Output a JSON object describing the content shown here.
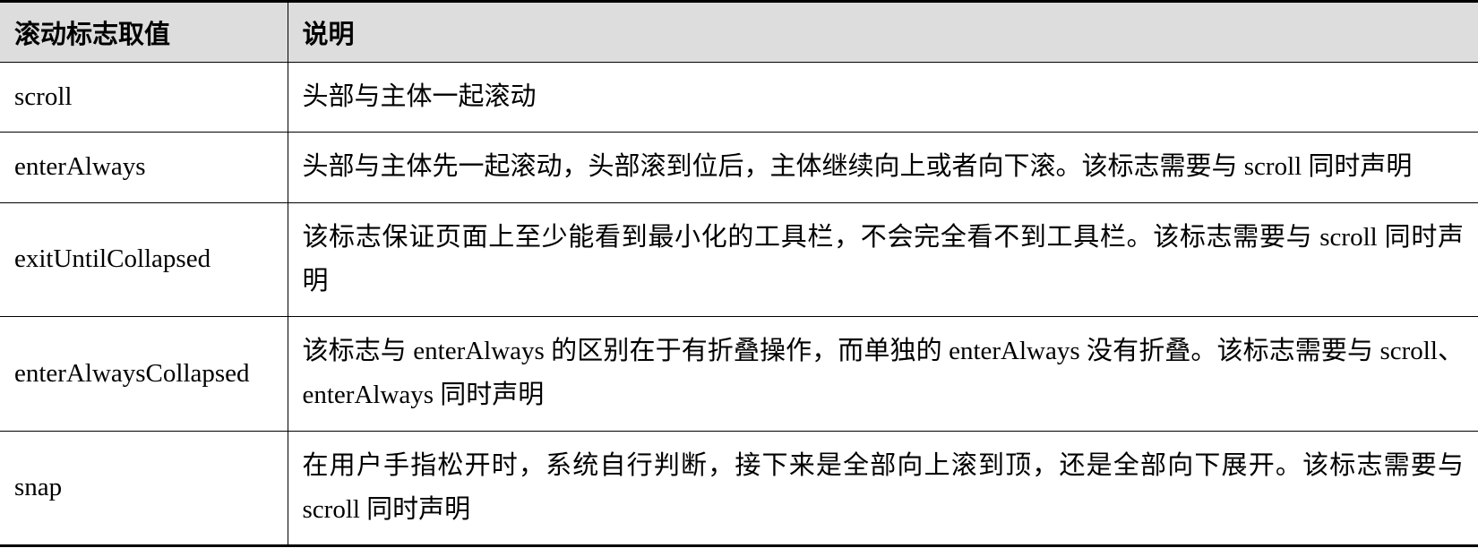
{
  "table": {
    "headers": {
      "value": "滚动标志取值",
      "description": "说明"
    },
    "rows": [
      {
        "value": "scroll",
        "description": "头部与主体一起滚动"
      },
      {
        "value": "enterAlways",
        "description": "头部与主体先一起滚动，头部滚到位后，主体继续向上或者向下滚。该标志需要与 scroll 同时声明"
      },
      {
        "value": "exitUntilCollapsed",
        "description": "该标志保证页面上至少能看到最小化的工具栏，不会完全看不到工具栏。该标志需要与 scroll 同时声明"
      },
      {
        "value": "enterAlwaysCollapsed",
        "description": "该标志与 enterAlways 的区别在于有折叠操作，而单独的 enterAlways 没有折叠。该标志需要与 scroll、enterAlways 同时声明"
      },
      {
        "value": "snap",
        "description": "在用户手指松开时，系统自行判断，接下来是全部向上滚到顶，还是全部向下展开。该标志需要与 scroll 同时声明"
      }
    ]
  }
}
